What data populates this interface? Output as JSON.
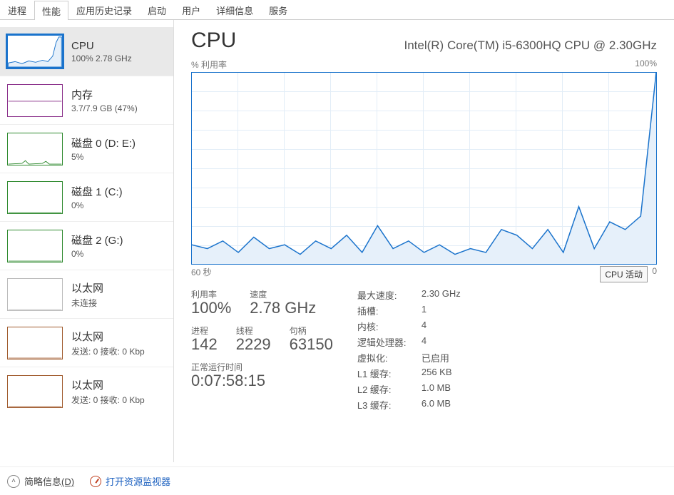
{
  "tabs": [
    "进程",
    "性能",
    "应用历史记录",
    "启动",
    "用户",
    "详细信息",
    "服务"
  ],
  "activeTabIndex": 1,
  "sidebar": [
    {
      "title": "CPU",
      "sub": "100%  2.78 GHz",
      "color": "#1a73cc",
      "type": "cpu"
    },
    {
      "title": "内存",
      "sub": "3.7/7.9 GB (47%)",
      "color": "#8a2f8a",
      "type": "mem"
    },
    {
      "title": "磁盘 0 (D: E:)",
      "sub": "5%",
      "color": "#2f8a2f",
      "type": "disk0"
    },
    {
      "title": "磁盘 1 (C:)",
      "sub": "0%",
      "color": "#2f8a2f",
      "type": "flat"
    },
    {
      "title": "磁盘 2 (G:)",
      "sub": "0%",
      "color": "#2f8a2f",
      "type": "flat"
    },
    {
      "title": "以太网",
      "sub": "未连接",
      "color": "#bbbbbb",
      "type": "flat"
    },
    {
      "title": "以太网",
      "sub": "发送: 0 接收: 0 Kbp",
      "color": "#a05a2c",
      "type": "flat"
    },
    {
      "title": "以太网",
      "sub": "发送: 0 接收: 0 Kbp",
      "color": "#a05a2c",
      "type": "flat"
    }
  ],
  "header": {
    "title": "CPU",
    "model": "Intel(R) Core(TM) i5-6300HQ CPU @ 2.30GHz"
  },
  "chartLabels": {
    "yLabel": "% 利用率",
    "yMax": "100%",
    "xLeft": "60 秒",
    "xRight": "0"
  },
  "tooltip": "CPU 活动",
  "statsLeft": {
    "row1": [
      {
        "lbl": "利用率",
        "val": "100%"
      },
      {
        "lbl": "速度",
        "val": "2.78 GHz"
      }
    ],
    "row2": [
      {
        "lbl": "进程",
        "val": "142"
      },
      {
        "lbl": "线程",
        "val": "2229"
      },
      {
        "lbl": "句柄",
        "val": "63150"
      }
    ],
    "uptime": {
      "lbl": "正常运行时间",
      "val": "0:07:58:15"
    }
  },
  "specs": [
    {
      "k": "最大速度:",
      "v": "2.30 GHz"
    },
    {
      "k": "插槽:",
      "v": "1"
    },
    {
      "k": "内核:",
      "v": "4"
    },
    {
      "k": "逻辑处理器:",
      "v": "4"
    },
    {
      "k": "虚拟化:",
      "v": "已启用"
    },
    {
      "k": "L1 缓存:",
      "v": "256 KB"
    },
    {
      "k": "L2 缓存:",
      "v": "1.0 MB"
    },
    {
      "k": "L3 缓存:",
      "v": "6.0 MB"
    }
  ],
  "footer": {
    "summary": "简略信息",
    "summaryKey": "(D)",
    "monitor": "打开资源监视器"
  },
  "chart_data": {
    "type": "line",
    "title": "% 利用率",
    "xlabel": "秒",
    "ylabel": "% 利用率",
    "xlim": [
      60,
      0
    ],
    "ylim": [
      0,
      100
    ],
    "x": [
      60,
      58,
      56,
      54,
      52,
      50,
      48,
      46,
      44,
      42,
      40,
      38,
      36,
      34,
      32,
      30,
      28,
      26,
      24,
      22,
      20,
      18,
      16,
      14,
      12,
      10,
      8,
      6,
      4,
      2,
      0
    ],
    "values": [
      10,
      8,
      12,
      6,
      14,
      8,
      10,
      5,
      12,
      8,
      15,
      6,
      20,
      8,
      12,
      6,
      10,
      5,
      8,
      6,
      18,
      15,
      8,
      18,
      6,
      30,
      8,
      22,
      18,
      25,
      100
    ]
  }
}
